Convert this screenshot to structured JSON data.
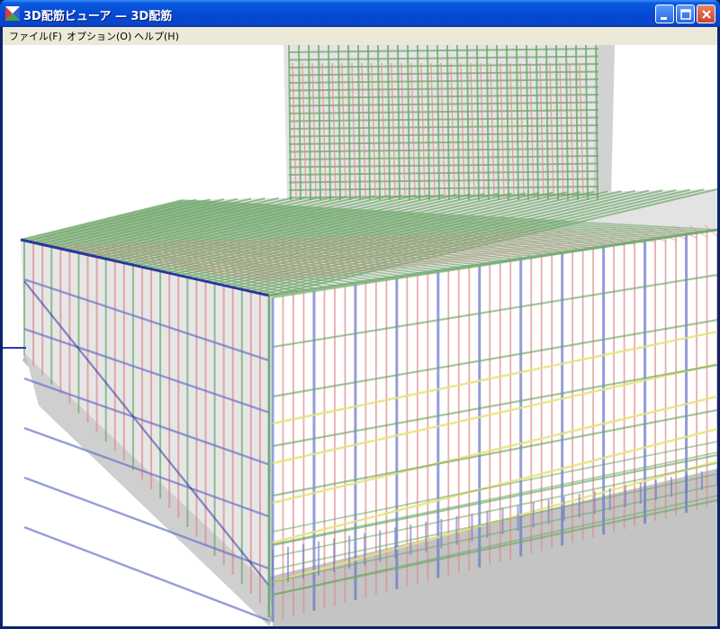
{
  "window": {
    "title": "3D配筋ビューア — 3D配筋",
    "icon": "app-icon",
    "controls": [
      "minimize-icon",
      "maximize-icon",
      "close-icon"
    ]
  },
  "menu": {
    "file": "ファイル(F)",
    "options": "オプション(O)",
    "help": "ヘルプ(H)"
  },
  "viewport": {
    "content": "3D rebar model rendering",
    "colors": {
      "concrete": "#cfcfcf",
      "rebar_green": "#6fa86a",
      "rebar_red": "#e08a8a",
      "rebar_blue": "#6b73c8",
      "rebar_yellow": "#e8e27a",
      "outline_blue": "#1b2a9a"
    }
  }
}
